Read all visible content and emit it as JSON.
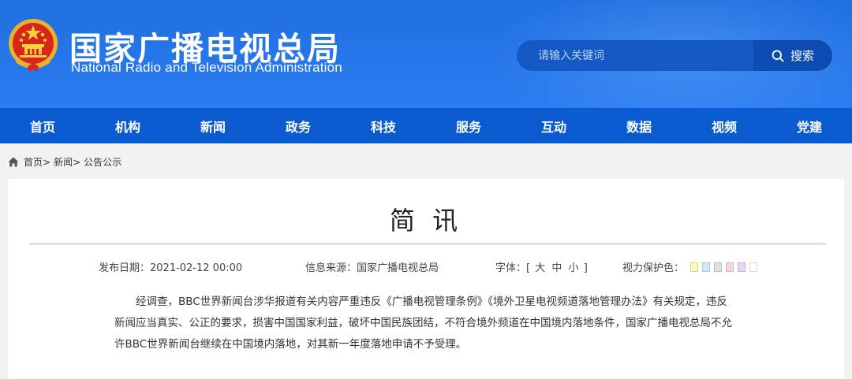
{
  "header": {
    "title_cn": "国家广播电视总局",
    "title_en": "National Radio and Television Administration",
    "emblem_icon": "national-emblem-icon",
    "colors": {
      "header_bg": "#2b7cf0",
      "nav_bg": "#0a5bd0",
      "search_bg": "#1358c4"
    }
  },
  "search": {
    "placeholder": "请输入关键词",
    "value": "",
    "button_label": "搜索",
    "icon": "search-icon"
  },
  "nav": {
    "items": [
      {
        "label": "首页"
      },
      {
        "label": "机构"
      },
      {
        "label": "新闻"
      },
      {
        "label": "政务"
      },
      {
        "label": "科技"
      },
      {
        "label": "服务"
      },
      {
        "label": "互动"
      },
      {
        "label": "数据"
      },
      {
        "label": "视频"
      },
      {
        "label": "党建"
      }
    ]
  },
  "breadcrumb": {
    "icon": "home-icon",
    "items": [
      "首页>",
      "新闻>",
      "公告公示"
    ]
  },
  "article": {
    "title": "简 讯",
    "meta": {
      "date": "发布日期：2021-02-12 00:00",
      "source": "信息来源：国家广播电视总局",
      "font_label": "字体：[",
      "font_large": "大",
      "font_medium": "中",
      "font_small": "小",
      "font_close": "]",
      "eye_label": "视力保护色："
    },
    "eye_colors": [
      "#fafab2",
      "#cfe9f5",
      "#e0e0e0",
      "#f7d6e0",
      "#e6d6f5",
      "#ffffff"
    ],
    "body": "经调查，BBC世界新闻台涉华报道有关内容严重违反《广播电视管理条例》《境外卫星电视频道落地管理办法》有关规定，违反新闻应当真实、公正的要求，损害中国国家利益，破坏中国民族团结，不符合境外频道在中国境内落地条件，国家广播电视总局不允许BBC世界新闻台继续在中国境内落地，对其新一年度落地申请不予受理。"
  }
}
